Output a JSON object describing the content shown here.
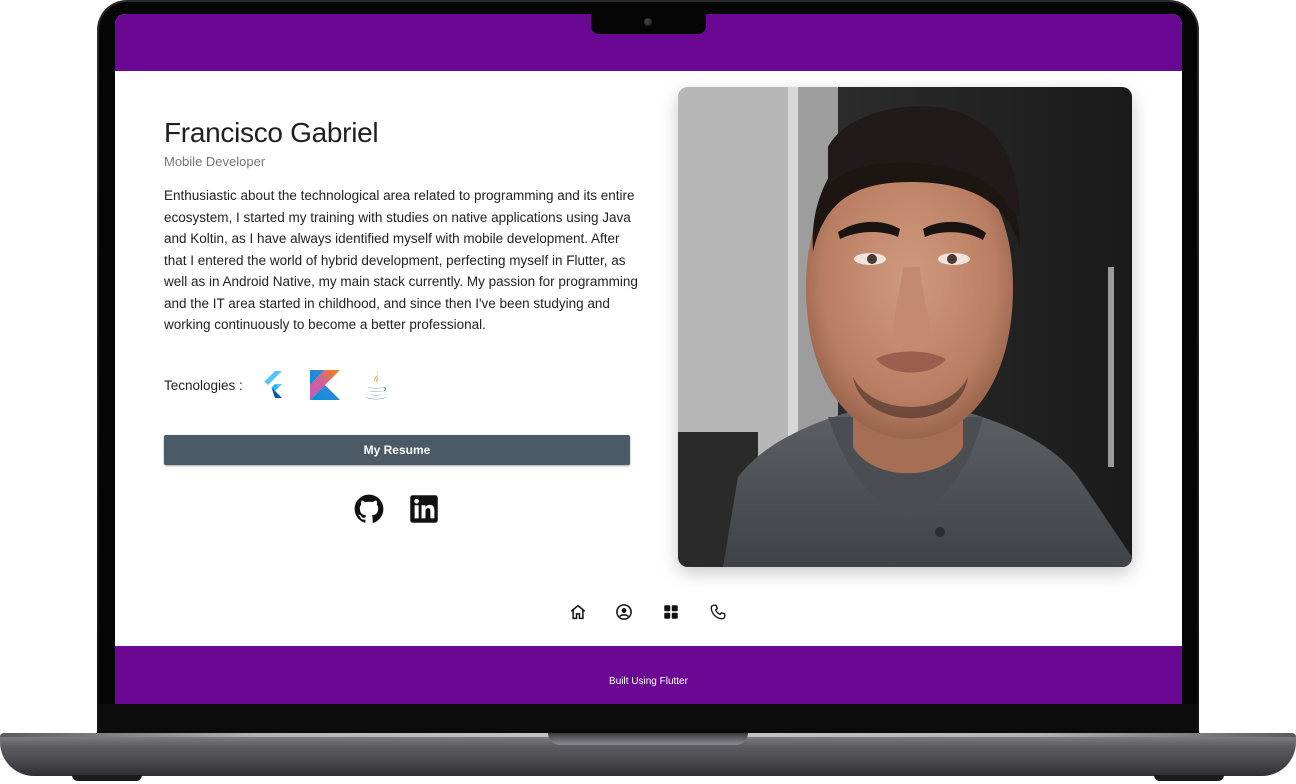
{
  "profile": {
    "name": "Francisco Gabriel",
    "role": "Mobile Developer",
    "bio": "Enthusiastic about the technological area related to programming and its entire ecosystem, I started my training with studies on native applications using Java and Koltin, as I have always identified myself with mobile development. After that I entered the world of hybrid development, perfecting myself in Flutter, as well as in Android Native, my main stack currently. My passion for programming and the IT area started in childhood, and since then I've been studying and working continuously to become a better professional."
  },
  "technologies": {
    "label": "Tecnologies :",
    "icons": [
      "flutter-icon",
      "kotlin-icon",
      "java-icon"
    ]
  },
  "actions": {
    "resume_label": "My Resume"
  },
  "social": {
    "icons": [
      "github-icon",
      "linkedin-icon"
    ]
  },
  "nav": {
    "icons": [
      "home-icon",
      "account-circle-icon",
      "grid-icon",
      "phone-icon"
    ]
  },
  "footer": {
    "text": "Built Using Flutter"
  },
  "colors": {
    "brand_purple": "#6a0793",
    "button_bg": "#4a5a66",
    "button_text": "#ffffff",
    "heading_text": "#1f1f1f",
    "muted_text": "#757575"
  }
}
